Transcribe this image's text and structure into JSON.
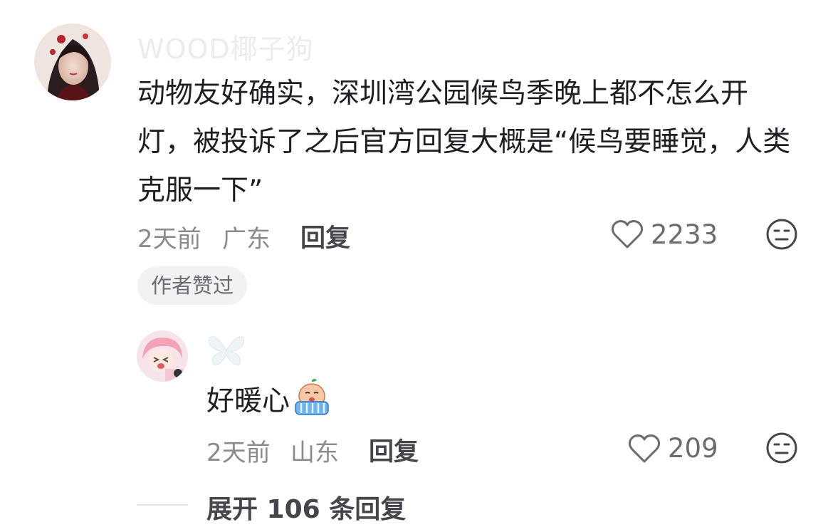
{
  "main_comment": {
    "username": "WOOD椰子狗",
    "text": "动物友好确实，深圳湾公园候鸟季晚上都不怎么开灯，被投诉了之后官方回复大概是“候鸟要睡觉，人类克服一下”",
    "time": "2天前",
    "location": "广东",
    "reply_label": "回复",
    "like_count": "2233",
    "author_liked_badge": "作者赞过"
  },
  "reply_comment": {
    "text": "好暖心",
    "time": "2天前",
    "location": "山东",
    "reply_label": "回复",
    "like_count": "209"
  },
  "expand_replies": {
    "label": "展开 106 条回复"
  },
  "colors": {
    "text_primary": "#1e1e24",
    "text_secondary": "#8a8b91",
    "icon_gray": "#6b6c72",
    "badge_bg": "#f2f2f4"
  },
  "icons": [
    "heart-icon",
    "neutral-face-icon",
    "crying-emoji-icon",
    "butterfly-icon"
  ]
}
